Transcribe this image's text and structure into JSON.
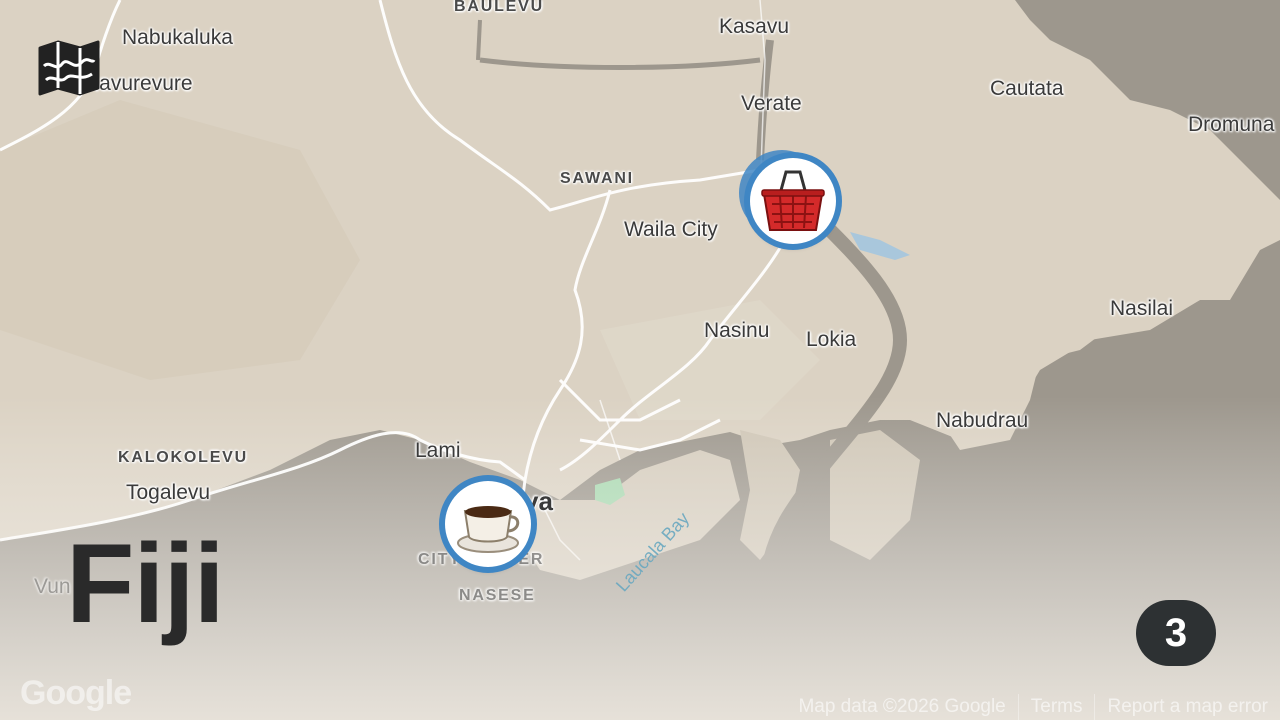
{
  "map": {
    "title": "Fiji",
    "badge_count": "3",
    "places": {
      "nabukaluka": "Nabukaluka",
      "vavurevure": "Navurevure",
      "baulevu": "BAULEVU",
      "kasavu": "Kasavu",
      "verate": "Verate",
      "cautata": "Cautata",
      "dromuna": "Dromuna",
      "sawani": "SAWANI",
      "waila_city": "Waila City",
      "nasinu": "Nasinu",
      "lokia": "Lokia",
      "nasilai": "Nasilai",
      "nabudrau": "Nabudrau",
      "lami": "Lami",
      "kalokolevu": "KALOKOLEVU",
      "togalevu": "Togalevu",
      "suva": "va",
      "city_center": "CITY CENTER",
      "nasese": "NASESE",
      "laucala_bay": "Laucala Bay",
      "vunivudi": "Vun"
    },
    "markers": [
      {
        "name": "shopping-basket-marker",
        "icon": "shopping-basket-icon"
      },
      {
        "name": "coffee-cup-marker",
        "icon": "coffee-cup-icon"
      }
    ],
    "attribution": {
      "google": "Google",
      "map_data": "Map data ©2026 Google",
      "terms": "Terms",
      "report": "Report a map error"
    },
    "colors": {
      "land": "#d9d0c1",
      "water": "#9b958b",
      "road": "#ffffff",
      "marker_ring": "#3f86c4",
      "badge_bg": "#2d3133"
    }
  }
}
